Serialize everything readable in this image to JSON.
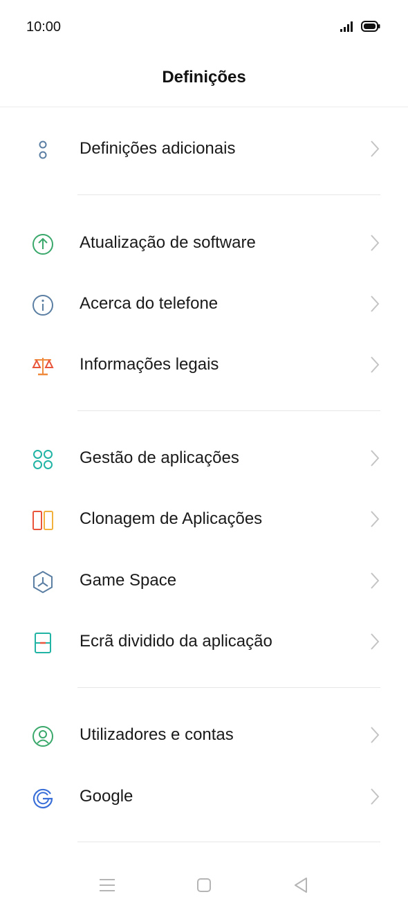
{
  "status_bar": {
    "time": "10:00"
  },
  "header": {
    "title": "Definições"
  },
  "items": [
    {
      "label": "Definições adicionais",
      "icon": "additional-settings-icon",
      "color": "#5b7ea3"
    },
    {
      "label": "Atualização de software",
      "icon": "software-update-icon",
      "color": "#3aa86b"
    },
    {
      "label": "Acerca do telefone",
      "icon": "info-icon",
      "color": "#5b7ea3"
    },
    {
      "label": "Informações legais",
      "icon": "legal-scale-icon",
      "color": "#ef8a3c"
    },
    {
      "label": "Gestão de aplicações",
      "icon": "app-management-icon",
      "color": "#21b3a4"
    },
    {
      "label": "Clonagem de Aplicações",
      "icon": "app-clone-icon",
      "color": "#e8553b"
    },
    {
      "label": "Game Space",
      "icon": "game-space-icon",
      "color": "#5b7ea3"
    },
    {
      "label": "Ecrã dividido da aplicação",
      "icon": "split-screen-icon",
      "color": "#21b3a4"
    },
    {
      "label": "Utilizadores e contas",
      "icon": "user-accounts-icon",
      "color": "#3aa86b"
    },
    {
      "label": "Google",
      "icon": "google-icon",
      "color": "#3b6fd8"
    }
  ],
  "navigation": {
    "menu": "menu-icon",
    "home": "home-icon",
    "back": "back-icon"
  }
}
